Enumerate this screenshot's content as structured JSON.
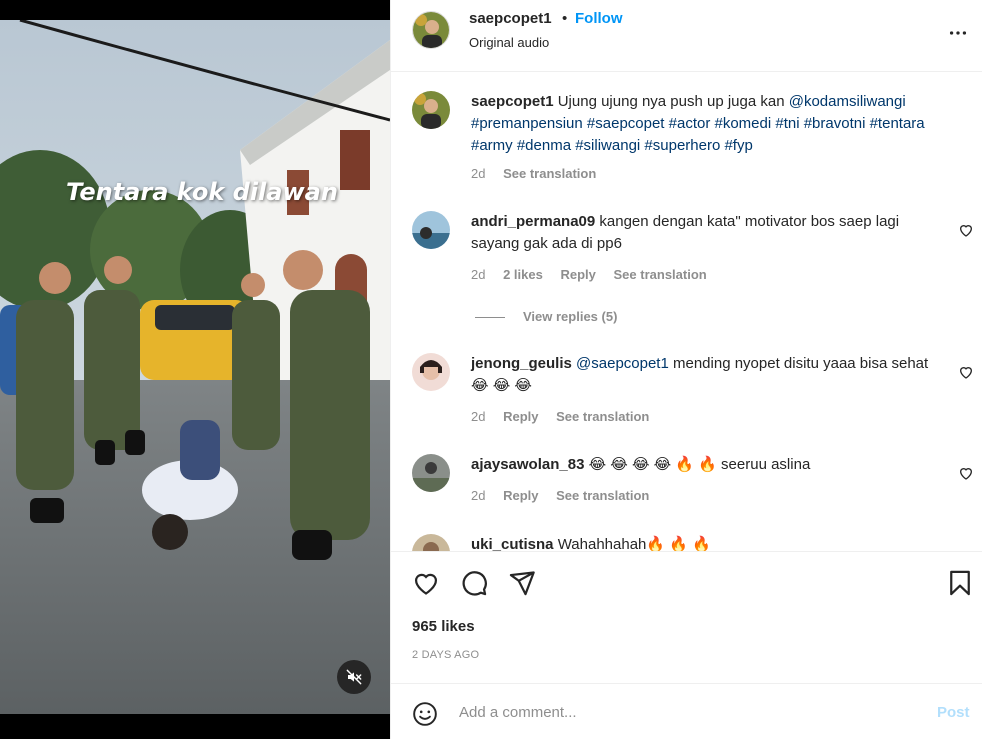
{
  "media": {
    "overlay_text": "Tentara kok dilawan",
    "mute_icon": "speaker-muted-icon"
  },
  "header": {
    "username": "saepcopet1",
    "separator": "•",
    "follow_label": "Follow",
    "audio": "Original audio",
    "more_icon": "more-options-icon"
  },
  "caption": {
    "username": "saepcopet1",
    "text_before": "Ujung ujung nya push up juga kan",
    "mention": "@kodamsiliwangi",
    "hashtags": "#premanpensiun #saepcopet #actor #komedi #tni #bravotni #tentara #army #denma #siliwangi #superhero #fyp",
    "age": "2d",
    "see_translation": "See translation"
  },
  "comments": [
    {
      "username": "andri_permana09",
      "text": "kangen dengan kata\" motivator bos saep lagi sayang gak ada di pp6",
      "age": "2d",
      "likes": "2 likes",
      "reply": "Reply",
      "see_translation": "See translation",
      "view_replies": "View replies (5)"
    },
    {
      "username": "jenong_geulis",
      "mention": "@saepcopet1",
      "text": "mending nyopet disitu yaaa bisa sehat😂 😂 😂",
      "age": "2d",
      "reply": "Reply",
      "see_translation": "See translation"
    },
    {
      "username": "ajaysawolan_83",
      "text": "😂 😂 😂 😂 🔥 🔥 seeruu aslina",
      "age": "2d",
      "reply": "Reply",
      "see_translation": "See translation"
    },
    {
      "username": "uki_cutisna",
      "text": "Wahahhahah🔥 🔥 🔥"
    }
  ],
  "actions": {
    "like_icon": "heart-icon",
    "comment_icon": "comment-icon",
    "share_icon": "share-icon",
    "save_icon": "bookmark-icon",
    "likes": "965 likes",
    "time_ago": "2 DAYS AGO"
  },
  "add_comment": {
    "placeholder": "Add a comment...",
    "post_label": "Post",
    "emoji_icon": "emoji-icon"
  },
  "colors": {
    "accent": "#0095f6",
    "link": "#00376b",
    "muted": "#8e8e8e",
    "post_disabled": "#b2dffc"
  }
}
